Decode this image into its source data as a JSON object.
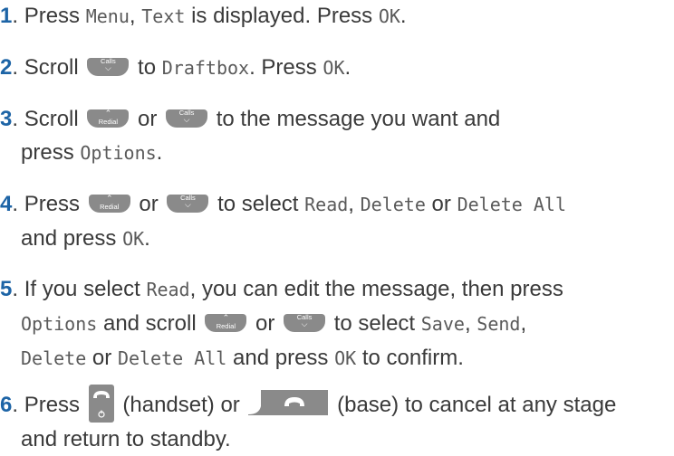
{
  "keys": {
    "calls": "Calls",
    "redial": "Redial"
  },
  "steps": [
    {
      "num": "1",
      "t1": ". Press ",
      "m1": "Menu",
      "t2": ", ",
      "m2": "Text",
      "t3": " is displayed. Press ",
      "m3": "OK",
      "t4": "."
    },
    {
      "num": "2",
      "t1": ". Scroll ",
      "t2": " to ",
      "m1": "Draftbox",
      "t3": ". Press ",
      "m2": "OK",
      "t4": "."
    },
    {
      "num": "3",
      "t1": ". Scroll ",
      "t2": " or ",
      "t3": " to the message you want and",
      "t4": "press ",
      "m1": "Options",
      "t5": "."
    },
    {
      "num": "4",
      "t1": ". Press ",
      "t2": " or ",
      "t3": " to select ",
      "m1": "Read",
      "t4": ", ",
      "m2": "Delete",
      "t5": " or ",
      "m3": "Delete All",
      "t6": "and press ",
      "m4": "OK",
      "t7": "."
    },
    {
      "num": "5",
      "t1": ". If you select ",
      "m1": "Read",
      "t2": ", you can edit the message, then press",
      "m2": "Options",
      "t3": " and scroll ",
      "t4": " or ",
      "t5": " to select ",
      "m3": "Save",
      "t6": ", ",
      "m4": "Send",
      "t7": ",",
      "m5": "Delete",
      "t8": " or ",
      "m6": "Delete All",
      "t9": " and press ",
      "m7": "OK",
      "t10": " to confirm."
    },
    {
      "num": "6",
      "t1": ". Press ",
      "t2": " (handset) or ",
      "t3": " (base) to cancel at any stage",
      "t4": "and return to standby."
    }
  ]
}
